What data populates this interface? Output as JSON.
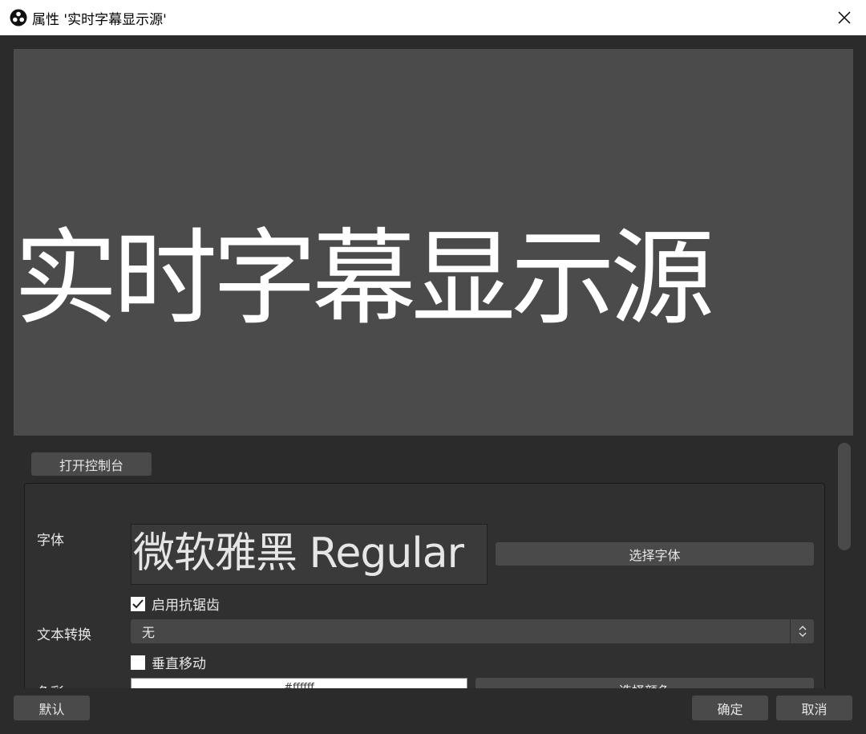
{
  "window": {
    "title": "属性 '实时字幕显示源'",
    "app_icon": "obs-icon",
    "close_icon": "close-icon"
  },
  "preview": {
    "text": "实时字幕显示源"
  },
  "toolbar": {
    "open_console_label": "打开控制台"
  },
  "properties": {
    "font_label": "字体",
    "font_preview": "微软雅黑 Regular",
    "select_font_label": "选择字体",
    "antialias_label": "启用抗锯齿",
    "antialias_checked": true,
    "text_transform_label": "文本转换",
    "text_transform_value": "无",
    "vertical_label": "垂直移动",
    "vertical_checked": false,
    "color_label": "色彩",
    "color_value": "#ffffff",
    "select_color_label": "选择颜色"
  },
  "footer": {
    "defaults_label": "默认",
    "ok_label": "确定",
    "cancel_label": "取消"
  },
  "colors": {
    "background": "#2b2b2b",
    "preview_bg": "#4b4b4b",
    "button": "#4a4a4a",
    "text": "#e6e6e6"
  }
}
